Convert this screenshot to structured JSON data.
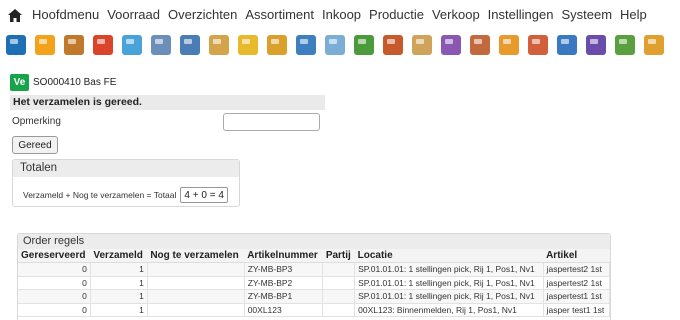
{
  "menu": {
    "home_icon": "home-icon",
    "items": [
      "Hoofdmenu",
      "Voorraad",
      "Overzichten",
      "Assortiment",
      "Inkoop",
      "Productie",
      "Verkoop",
      "Instellingen",
      "Systeem",
      "Help"
    ]
  },
  "toolbar": {
    "icons": [
      {
        "name": "phone-icon",
        "color": "#1f6fb5"
      },
      {
        "name": "folder-icon",
        "color": "#f2a31b"
      },
      {
        "name": "pallet-icon",
        "color": "#c0782a"
      },
      {
        "name": "package-icon",
        "color": "#d9442b"
      },
      {
        "name": "document-icon",
        "color": "#4aa3d8"
      },
      {
        "name": "grid-icon",
        "color": "#6b8fb8"
      },
      {
        "name": "box-add-icon",
        "color": "#4a7db5"
      },
      {
        "name": "tray-icon",
        "color": "#d4a44a"
      },
      {
        "name": "box-plus-icon",
        "color": "#e8b92a"
      },
      {
        "name": "box-star-icon",
        "color": "#d9a02c"
      },
      {
        "name": "search-icon",
        "color": "#3e7fbf"
      },
      {
        "name": "zoom-icon",
        "color": "#7aaed6"
      },
      {
        "name": "globe-icon",
        "color": "#4b9b3c"
      },
      {
        "name": "box-check-icon",
        "color": "#c75a2a"
      },
      {
        "name": "box-edit-icon",
        "color": "#d0a35a"
      },
      {
        "name": "pen-icon",
        "color": "#8a58b2"
      },
      {
        "name": "box-doc-icon",
        "color": "#c26a3d"
      },
      {
        "name": "user-box-icon",
        "color": "#e89a2c"
      },
      {
        "name": "box-link-icon",
        "color": "#d25f3b"
      },
      {
        "name": "box-blue-icon",
        "color": "#3b78c2"
      },
      {
        "name": "box-write-icon",
        "color": "#6a4dab"
      },
      {
        "name": "box-green-icon",
        "color": "#5aa040"
      },
      {
        "name": "user-icon",
        "color": "#e0a030"
      }
    ]
  },
  "record": {
    "badge": "Ve",
    "id": "SO000410 Bas FE"
  },
  "status": "Het verzamelen is gereed.",
  "remark": {
    "label": "Opmerking",
    "value": "",
    "placeholder": ""
  },
  "done_button": "Gereed",
  "totals": {
    "title": "Totalen",
    "formula_label": "Verzameld + Nog te verzamelen = Totaal",
    "calc": "4 + 0 = 4"
  },
  "order_lines": {
    "title": "Order regels",
    "columns": [
      "Gereserveerd",
      "Verzameld",
      "Nog te verzamelen",
      "Artikelnummer",
      "Partij",
      "Locatie",
      "Artikel"
    ],
    "rows": [
      [
        "0",
        "1",
        "",
        "ZY-MB-BP3",
        "",
        "SP.01.01.01: 1 stellingen pick, Rij 1, Pos1, Nv1",
        "jaspertest2 1st"
      ],
      [
        "0",
        "1",
        "",
        "ZY-MB-BP2",
        "",
        "SP.01.01.01: 1 stellingen pick, Rij 1, Pos1, Nv1",
        "jaspertest2 1st"
      ],
      [
        "0",
        "1",
        "",
        "ZY-MB-BP1",
        "",
        "SP.01.01.01: 1 stellingen pick, Rij 1, Pos1, Nv1",
        "jaspertest1 1st"
      ],
      [
        "0",
        "1",
        "",
        "00XL123",
        "",
        "00XL123: Binnenmelden, Rij 1, Pos1, Nv1",
        "jasper test1 1st"
      ]
    ]
  }
}
